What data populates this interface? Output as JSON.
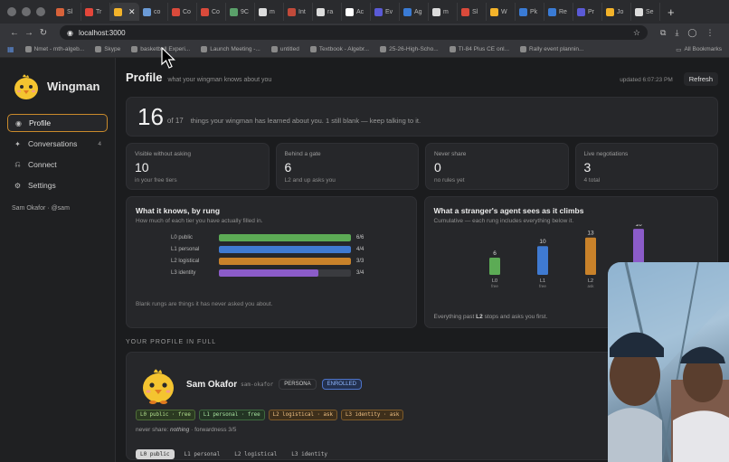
{
  "browser": {
    "tabs": [
      "Sl",
      "Tr",
      "",
      "co",
      "Co",
      "Co",
      "9C",
      "m",
      "Int",
      "ra",
      "Ac",
      "Ev",
      "Ag",
      "m",
      "Sl",
      "W",
      "Pk",
      "Re",
      "Pr",
      "Jo",
      "Se"
    ],
    "active_tab_index": 2,
    "tab_colors": [
      "#d7623a",
      "#e3463a",
      "#f3b32a",
      "#6a9ad6",
      "#d94a3b",
      "#d94a3b",
      "#5aa06a",
      "#dcdcdc",
      "#c14a3a",
      "#dcdcdc",
      "#ffffff",
      "#5a5ad6",
      "#3a7bd5",
      "#dcdcdc",
      "#d94a3b",
      "#f3b32a",
      "#3a7bd5",
      "#3a7bd5",
      "#5a5ad6",
      "#f3b32a",
      "#dcdcdc"
    ],
    "url": "localhost:3000",
    "bookmarks": [
      "Nmet - mth-algeb...",
      "Skype",
      "basketball Experi...",
      "Launch Meeting -...",
      "untitled",
      "Textbook - Algebr...",
      "25-26-High-Scho...",
      "TI-84 Plus CE onl...",
      "Rally event plannin..."
    ],
    "all_bookmarks": "All Bookmarks"
  },
  "brand": {
    "name": "Wingman"
  },
  "nav": [
    {
      "label": "Profile",
      "icon": "dot-icon",
      "badge": ""
    },
    {
      "label": "Conversations",
      "icon": "plus-icon",
      "badge": "4"
    },
    {
      "label": "Connect",
      "icon": "connect-icon",
      "badge": ""
    },
    {
      "label": "Settings",
      "icon": "gear-icon",
      "badge": ""
    }
  ],
  "user_line": "Sam Okafor · @sam",
  "header": {
    "title": "Profile",
    "subtitle": "what your wingman knows about you",
    "updated": "updated 6:07:23 PM",
    "refresh_label": "Refresh"
  },
  "hero": {
    "count": "16",
    "of": "of 17",
    "text": "things your wingman has learned about you. 1 still blank — keep talking to it."
  },
  "stats": [
    {
      "label": "Visible without asking",
      "value": "10",
      "sub": "in your free tiers"
    },
    {
      "label": "Behind a gate",
      "value": "6",
      "sub": "L2 and up asks you"
    },
    {
      "label": "Never share",
      "value": "0",
      "sub": "no rules yet"
    },
    {
      "label": "Live negotiations",
      "value": "3",
      "sub": "4 total"
    }
  ],
  "rungs_panel": {
    "title": "What it knows, by rung",
    "subtitle": "How much of each tier you have actually filled in.",
    "note": "Blank rungs are things it has never asked you about."
  },
  "climb_panel": {
    "title": "What a stranger's agent sees as it climbs",
    "subtitle": "Cumulative — each rung includes everything below it.",
    "footer_prefix": "Everything past",
    "footer_bold": "L2",
    "footer_suffix": "stops and asks you first."
  },
  "chart_data": [
    {
      "type": "bar",
      "orientation": "horizontal",
      "categories": [
        "L0 public",
        "L1 personal",
        "L2 logistical",
        "L3 identity"
      ],
      "values": [
        6,
        4,
        3,
        3
      ],
      "totals": [
        6,
        4,
        3,
        4
      ],
      "labels": [
        "6/6",
        "4/4",
        "3/3",
        "3/4"
      ],
      "colors": [
        "#5cab55",
        "#3f7ad1",
        "#c9822a",
        "#8b5cc9"
      ]
    },
    {
      "type": "bar",
      "categories": [
        "L0",
        "L1",
        "L2",
        "L3"
      ],
      "category_sublabels": [
        "free",
        "free",
        "ask",
        "ask"
      ],
      "values": [
        6,
        10,
        13,
        16
      ],
      "ylim": [
        0,
        17
      ],
      "colors": [
        "#5cab55",
        "#3f7ad1",
        "#c9822a",
        "#8b5cc9"
      ]
    }
  ],
  "profile_section": {
    "heading": "YOUR PROFILE IN FULL",
    "name": "Sam Okafor",
    "handle": "sam-okafor",
    "persona_label": "PERSONA",
    "enrolled_label": "ENROLLED",
    "tiers": [
      "L0 public · free",
      "L1 personal · free",
      "L2 logistical · ask",
      "L3 identity · ask"
    ],
    "never_prefix": "never share:",
    "never_value": "nothing",
    "never_suffix": "· forwardness 3/5",
    "sub_tabs": [
      "L0 public",
      "L1 personal",
      "L2 logistical",
      "L3 identity"
    ]
  }
}
